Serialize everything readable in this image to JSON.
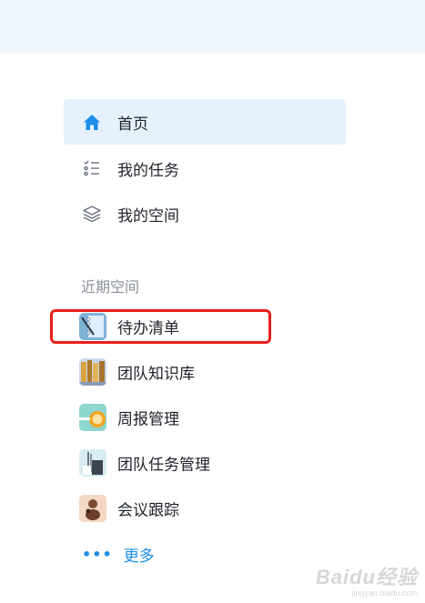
{
  "nav": {
    "items": [
      {
        "label": "首页",
        "icon": "home-icon",
        "active": true
      },
      {
        "label": "我的任务",
        "icon": "task-list-icon",
        "active": false
      },
      {
        "label": "我的空间",
        "icon": "layers-icon",
        "active": false
      }
    ]
  },
  "recent": {
    "title": "近期空间",
    "items": [
      {
        "label": "待办清单",
        "icon": "todo-notebook-thumbnail"
      },
      {
        "label": "团队知识库",
        "icon": "knowledge-base-thumbnail"
      },
      {
        "label": "周报管理",
        "icon": "weekly-report-thumbnail"
      },
      {
        "label": "团队任务管理",
        "icon": "team-tasks-thumbnail"
      },
      {
        "label": "会议跟踪",
        "icon": "meeting-tracking-thumbnail"
      }
    ],
    "more_label": "更多"
  },
  "watermark": {
    "main": "Baidu经验",
    "sub": "jingyan.baidu.com"
  },
  "colors": {
    "accent": "#1d8fe8",
    "active_bg": "#e5f1fc",
    "top_band": "#eef5fc",
    "highlight": "#e8201c",
    "muted_text": "#8a8f99"
  }
}
